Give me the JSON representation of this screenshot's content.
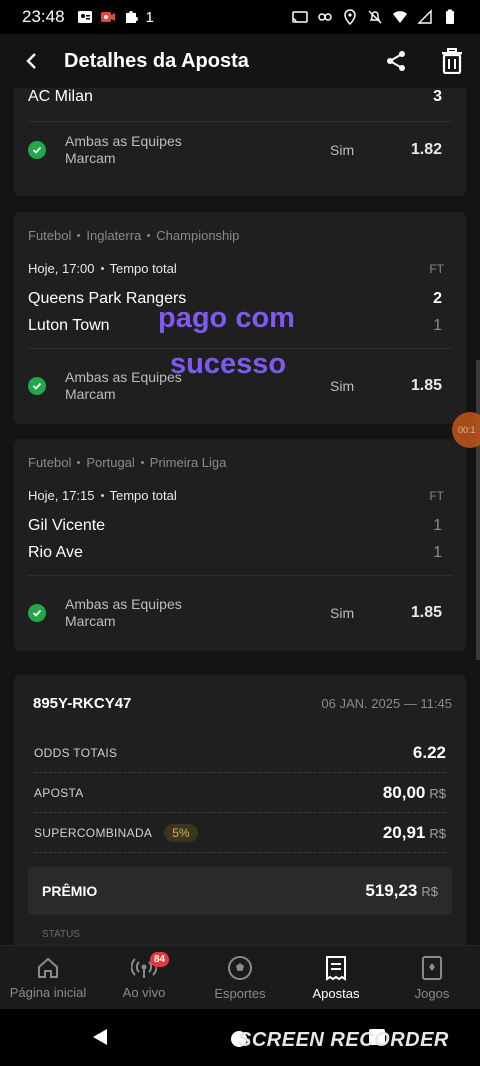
{
  "status_bar": {
    "time": "23:48",
    "notification_count": "1"
  },
  "header": {
    "title": "Detalhes da Aposta"
  },
  "card1": {
    "team": "AC Milan",
    "score": "3",
    "market": "Ambas as Equipes Marcam",
    "pick": "Sim",
    "odd": "1.82"
  },
  "card2": {
    "sport": "Futebol",
    "country": "Inglaterra",
    "league": "Championship",
    "time": "Hoje, 17:00",
    "period": "Tempo total",
    "status": "FT",
    "home_team": "Queens Park Rangers",
    "home_score": "2",
    "away_team": "Luton Town",
    "away_score": "1",
    "market": "Ambas as Equipes Marcam",
    "pick": "Sim",
    "odd": "1.85"
  },
  "card3": {
    "sport": "Futebol",
    "country": "Portugal",
    "league": "Primeira Liga",
    "time": "Hoje, 17:15",
    "period": "Tempo total",
    "status": "FT",
    "home_team": "Gil Vicente",
    "home_score": "1",
    "away_team": "Rio Ave",
    "away_score": "1",
    "market": "Ambas as Equipes Marcam",
    "pick": "Sim",
    "odd": "1.85"
  },
  "overlay": {
    "line1": "pago com",
    "line2": "sucesso"
  },
  "summary": {
    "bet_id": "895Y-RKCY47",
    "date": "06 JAN. 2025 — 11:45",
    "odds_label": "ODDS TOTAIS",
    "odds_value": "6.22",
    "stake_label": "APOSTA",
    "stake_value": "80,00",
    "boost_label": "SUPERCOMBINADA",
    "boost_badge": "5%",
    "boost_value": "20,91",
    "prize_label": "PRÊMIO",
    "prize_value": "519,23",
    "currency": "R$",
    "status_peek": "STATUS"
  },
  "recorder": {
    "timer": "00:1"
  },
  "nav": {
    "items": [
      {
        "label": "Página inicial",
        "icon": "home-icon"
      },
      {
        "label": "Ao vivo",
        "icon": "live-icon",
        "badge": "84"
      },
      {
        "label": "Esportes",
        "icon": "soccer-ball-icon"
      },
      {
        "label": "Apostas",
        "icon": "bet-slip-icon",
        "active": true
      },
      {
        "label": "Jogos",
        "icon": "cards-icon"
      }
    ]
  },
  "watermark": "SCREEN RECORDER",
  "colors": {
    "accent_purple": "#7f5af0",
    "success_green": "#22a84a",
    "badge_red": "#e23a3a",
    "gold": "#d9b54a"
  }
}
